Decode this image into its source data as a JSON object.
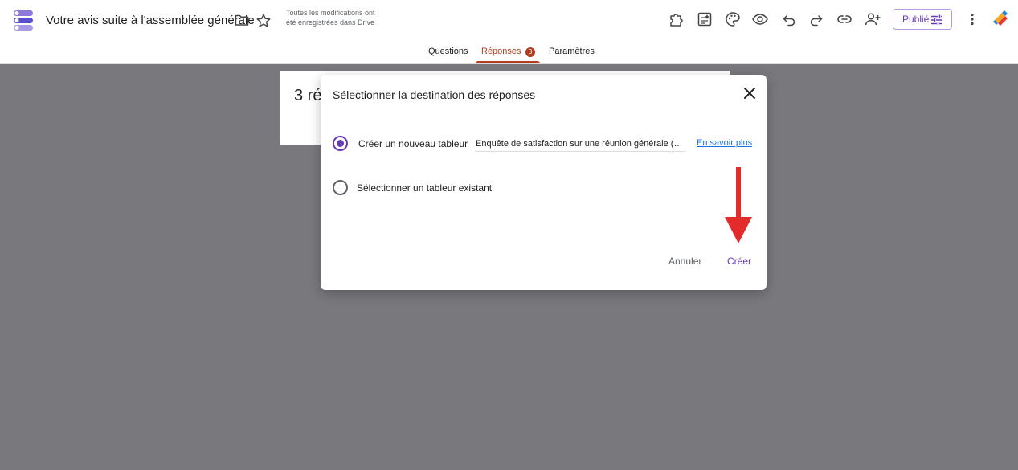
{
  "header": {
    "title": "Votre avis suite à l'assemblée générale",
    "save_status": "Toutes les modifications ont été enregistrées dans Drive",
    "publish_label": "Publié",
    "icons": [
      "addons-icon",
      "customize-theme-icon",
      "palette-icon",
      "preview-icon",
      "undo-icon",
      "redo-icon",
      "link-icon",
      "add-collaborator-icon",
      "more-vert-icon"
    ]
  },
  "tabs": {
    "items": [
      {
        "label": "Questions",
        "active": false
      },
      {
        "label": "Réponses",
        "active": true
      },
      {
        "label": "Paramètres",
        "active": false
      }
    ],
    "badge": "3"
  },
  "background_card": {
    "title": "3 ré"
  },
  "dialog": {
    "title": "Sélectionner la destination des réponses",
    "option_new": "Créer un nouveau tableur",
    "new_sheet_name": "Enquête de satisfaction sur une réunion générale (…",
    "learn_more": "En savoir plus",
    "option_existing": "Sélectionner un tableur existant",
    "selected_option": "new",
    "cancel_label": "Annuler",
    "create_label": "Créer"
  },
  "colors": {
    "accent": "#673ab7",
    "tab_active": "#b23d1f",
    "backdrop": "#79787d",
    "annotation_arrow": "#e32b2b"
  }
}
